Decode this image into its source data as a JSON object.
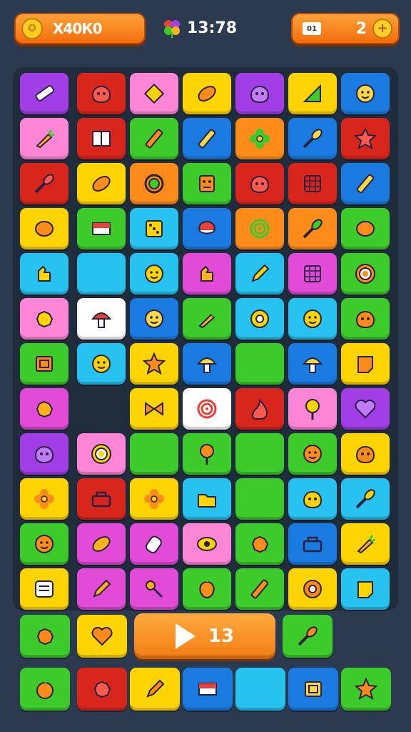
{
  "header": {
    "score": "X40К0",
    "time": "13:78",
    "battery_label": "01",
    "lives": "2",
    "plus_symbol": "+"
  },
  "board": {
    "tiles": [
      {
        "r": 0,
        "c": 0,
        "color": "#a23ee6",
        "icon": "eraser-icon"
      },
      {
        "r": 0,
        "c": 1,
        "color": "#d9261c",
        "icon": "monster-icon"
      },
      {
        "r": 0,
        "c": 2,
        "color": "#ff86d6",
        "icon": "diamond-icon"
      },
      {
        "r": 0,
        "c": 3,
        "color": "#ffd400",
        "icon": "candy-icon"
      },
      {
        "r": 0,
        "c": 4,
        "color": "#a23ee6",
        "icon": "monster-icon"
      },
      {
        "r": 0,
        "c": 5,
        "color": "#ffd400",
        "icon": "leaf-icon"
      },
      {
        "r": 0,
        "c": 6,
        "color": "#1a7ae0",
        "icon": "face-icon"
      },
      {
        "r": 1,
        "c": 0,
        "color": "#ff86d6",
        "icon": "carrot-icon"
      },
      {
        "r": 1,
        "c": 1,
        "color": "#d9261c",
        "icon": "book-icon"
      },
      {
        "r": 1,
        "c": 2,
        "color": "#3ccb2a",
        "icon": "crayon-icon"
      },
      {
        "r": 1,
        "c": 3,
        "color": "#1a7ae0",
        "icon": "crayon-icon"
      },
      {
        "r": 1,
        "c": 4,
        "color": "#ff8b1a",
        "icon": "flower-icon"
      },
      {
        "r": 1,
        "c": 5,
        "color": "#1a7ae0",
        "icon": "brush-icon"
      },
      {
        "r": 1,
        "c": 6,
        "color": "#d9261c",
        "icon": "star-icon"
      },
      {
        "r": 2,
        "c": 0,
        "color": "#d9261c",
        "icon": "brush-icon"
      },
      {
        "r": 2,
        "c": 1,
        "color": "#ffd400",
        "icon": "candy-icon"
      },
      {
        "r": 2,
        "c": 2,
        "color": "#ff8b1a",
        "icon": "ring-icon"
      },
      {
        "r": 2,
        "c": 3,
        "color": "#3ccb2a",
        "icon": "robot-icon"
      },
      {
        "r": 2,
        "c": 4,
        "color": "#d9261c",
        "icon": "monster-icon"
      },
      {
        "r": 2,
        "c": 5,
        "color": "#d9261c",
        "icon": "grid-icon"
      },
      {
        "r": 2,
        "c": 6,
        "color": "#1a7ae0",
        "icon": "crayon-icon"
      },
      {
        "r": 3,
        "c": 0,
        "color": "#ffd400",
        "icon": "gem-icon"
      },
      {
        "r": 3,
        "c": 1,
        "color": "#3ccb2a",
        "icon": "flag-icon"
      },
      {
        "r": 3,
        "c": 2,
        "color": "#27c2f0",
        "icon": "dice-icon"
      },
      {
        "r": 3,
        "c": 3,
        "color": "#1a7ae0",
        "icon": "cup-icon"
      },
      {
        "r": 3,
        "c": 4,
        "color": "#ff8b1a",
        "icon": "spiral-icon"
      },
      {
        "r": 3,
        "c": 5,
        "color": "#ff8b1a",
        "icon": "brush-icon"
      },
      {
        "r": 3,
        "c": 6,
        "color": "#3ccb2a",
        "icon": "gem-icon"
      },
      {
        "r": 4,
        "c": 0,
        "color": "#27c2f0",
        "icon": "hand-icon"
      },
      {
        "r": 4,
        "c": 1,
        "color": "#27c2f0",
        "icon": ""
      },
      {
        "r": 4,
        "c": 2,
        "color": "#27c2f0",
        "icon": "face-icon"
      },
      {
        "r": 4,
        "c": 3,
        "color": "#e14bd8",
        "icon": "hand-icon"
      },
      {
        "r": 4,
        "c": 4,
        "color": "#27c2f0",
        "icon": "pencil-icon"
      },
      {
        "r": 4,
        "c": 5,
        "color": "#e14bd8",
        "icon": "grid-icon"
      },
      {
        "r": 4,
        "c": 6,
        "color": "#3ccb2a",
        "icon": "target-icon"
      },
      {
        "r": 5,
        "c": 0,
        "color": "#ff86d6",
        "icon": "splat-icon"
      },
      {
        "r": 5,
        "c": 1,
        "color": "#ffffff",
        "icon": "mushroom-icon"
      },
      {
        "r": 5,
        "c": 2,
        "color": "#1a7ae0",
        "icon": "face-icon"
      },
      {
        "r": 5,
        "c": 3,
        "color": "#3ccb2a",
        "icon": "carrot-icon"
      },
      {
        "r": 5,
        "c": 4,
        "color": "#27c2f0",
        "icon": "donut-icon"
      },
      {
        "r": 5,
        "c": 5,
        "color": "#27c2f0",
        "icon": "face-icon"
      },
      {
        "r": 5,
        "c": 6,
        "color": "#3ccb2a",
        "icon": "monster-icon"
      },
      {
        "r": 6,
        "c": 0,
        "color": "#3ccb2a",
        "icon": "frame-icon"
      },
      {
        "r": 6,
        "c": 1,
        "color": "#27c2f0",
        "icon": "face-icon"
      },
      {
        "r": 6,
        "c": 2,
        "color": "#ffd400",
        "icon": "star-icon"
      },
      {
        "r": 6,
        "c": 3,
        "color": "#1a7ae0",
        "icon": "mushroom-icon"
      },
      {
        "r": 6,
        "c": 4,
        "color": "#3ccb2a",
        "icon": ""
      },
      {
        "r": 6,
        "c": 5,
        "color": "#1a7ae0",
        "icon": "mushroom-icon"
      },
      {
        "r": 6,
        "c": 6,
        "color": "#ffd400",
        "icon": "note-icon"
      },
      {
        "r": 7,
        "c": 0,
        "color": "#e14bd8",
        "icon": "splat-icon"
      },
      {
        "r": 7,
        "c": 2,
        "color": "#ffd400",
        "icon": "bow-icon"
      },
      {
        "r": 7,
        "c": 3,
        "color": "#ffffff",
        "icon": "spiral-icon"
      },
      {
        "r": 7,
        "c": 4,
        "color": "#d9261c",
        "icon": "flame-icon"
      },
      {
        "r": 7,
        "c": 5,
        "color": "#ff86d6",
        "icon": "lollipop-icon"
      },
      {
        "r": 7,
        "c": 6,
        "color": "#a23ee6",
        "icon": "heart-icon"
      },
      {
        "r": 8,
        "c": 0,
        "color": "#a23ee6",
        "icon": "monster-icon"
      },
      {
        "r": 8,
        "c": 1,
        "color": "#ff86d6",
        "icon": "target-icon"
      },
      {
        "r": 8,
        "c": 2,
        "color": "#3ccb2a",
        "icon": ""
      },
      {
        "r": 8,
        "c": 3,
        "color": "#3ccb2a",
        "icon": "lollipop-icon"
      },
      {
        "r": 8,
        "c": 4,
        "color": "#3ccb2a",
        "icon": ""
      },
      {
        "r": 8,
        "c": 5,
        "color": "#3ccb2a",
        "icon": "face-icon"
      },
      {
        "r": 8,
        "c": 6,
        "color": "#ffd400",
        "icon": "monster-icon"
      },
      {
        "r": 9,
        "c": 0,
        "color": "#ffd400",
        "icon": "flower-icon"
      },
      {
        "r": 9,
        "c": 1,
        "color": "#d9261c",
        "icon": "basket-icon"
      },
      {
        "r": 9,
        "c": 2,
        "color": "#ffd400",
        "icon": "flower-icon"
      },
      {
        "r": 9,
        "c": 3,
        "color": "#27c2f0",
        "icon": "folder-icon"
      },
      {
        "r": 9,
        "c": 4,
        "color": "#3ccb2a",
        "icon": ""
      },
      {
        "r": 9,
        "c": 5,
        "color": "#27c2f0",
        "icon": "monster-icon"
      },
      {
        "r": 9,
        "c": 6,
        "color": "#27c2f0",
        "icon": "brush-icon"
      },
      {
        "r": 10,
        "c": 0,
        "color": "#3ccb2a",
        "icon": "face-icon"
      },
      {
        "r": 10,
        "c": 1,
        "color": "#e14bd8",
        "icon": "candy-icon"
      },
      {
        "r": 10,
        "c": 2,
        "color": "#e14bd8",
        "icon": "bottle-icon"
      },
      {
        "r": 10,
        "c": 3,
        "color": "#ff86d6",
        "icon": "eye-icon"
      },
      {
        "r": 10,
        "c": 4,
        "color": "#3ccb2a",
        "icon": "splat-icon"
      },
      {
        "r": 10,
        "c": 5,
        "color": "#1a7ae0",
        "icon": "basket-icon"
      },
      {
        "r": 10,
        "c": 6,
        "color": "#ffd400",
        "icon": "carrot-icon"
      },
      {
        "r": 11,
        "c": 0,
        "color": "#ffd400",
        "icon": "pad-icon"
      },
      {
        "r": 11,
        "c": 1,
        "color": "#e14bd8",
        "icon": "pencil-icon"
      },
      {
        "r": 11,
        "c": 2,
        "color": "#e14bd8",
        "icon": "spoon-icon"
      },
      {
        "r": 11,
        "c": 3,
        "color": "#3ccb2a",
        "icon": "pepper-icon"
      },
      {
        "r": 11,
        "c": 4,
        "color": "#3ccb2a",
        "icon": "crayon-icon"
      },
      {
        "r": 11,
        "c": 5,
        "color": "#ffd400",
        "icon": "donut-icon"
      },
      {
        "r": 11,
        "c": 6,
        "color": "#27c2f0",
        "icon": "note-icon"
      }
    ]
  },
  "bottom": {
    "row1": [
      {
        "c": 0,
        "color": "#3ccb2a",
        "icon": "splat-icon"
      },
      {
        "c": 1,
        "color": "#ffd400",
        "icon": "heart-icon"
      },
      {
        "c": 5,
        "color": "#3ccb2a",
        "icon": "brush-icon"
      }
    ],
    "play_count": "13",
    "row2": [
      {
        "c": 0,
        "color": "#3ccb2a",
        "icon": "apple-icon"
      },
      {
        "c": 1,
        "color": "#d9261c",
        "icon": "splat-icon"
      },
      {
        "c": 2,
        "color": "#ffd400",
        "icon": "pencil-icon"
      },
      {
        "c": 3,
        "color": "#1a7ae0",
        "icon": "flag-icon"
      },
      {
        "c": 4,
        "color": "#27c2f0",
        "icon": ""
      },
      {
        "c": 5,
        "color": "#1a7ae0",
        "icon": "frame-icon"
      },
      {
        "c": 6,
        "color": "#3ccb2a",
        "icon": "star-icon"
      }
    ]
  }
}
